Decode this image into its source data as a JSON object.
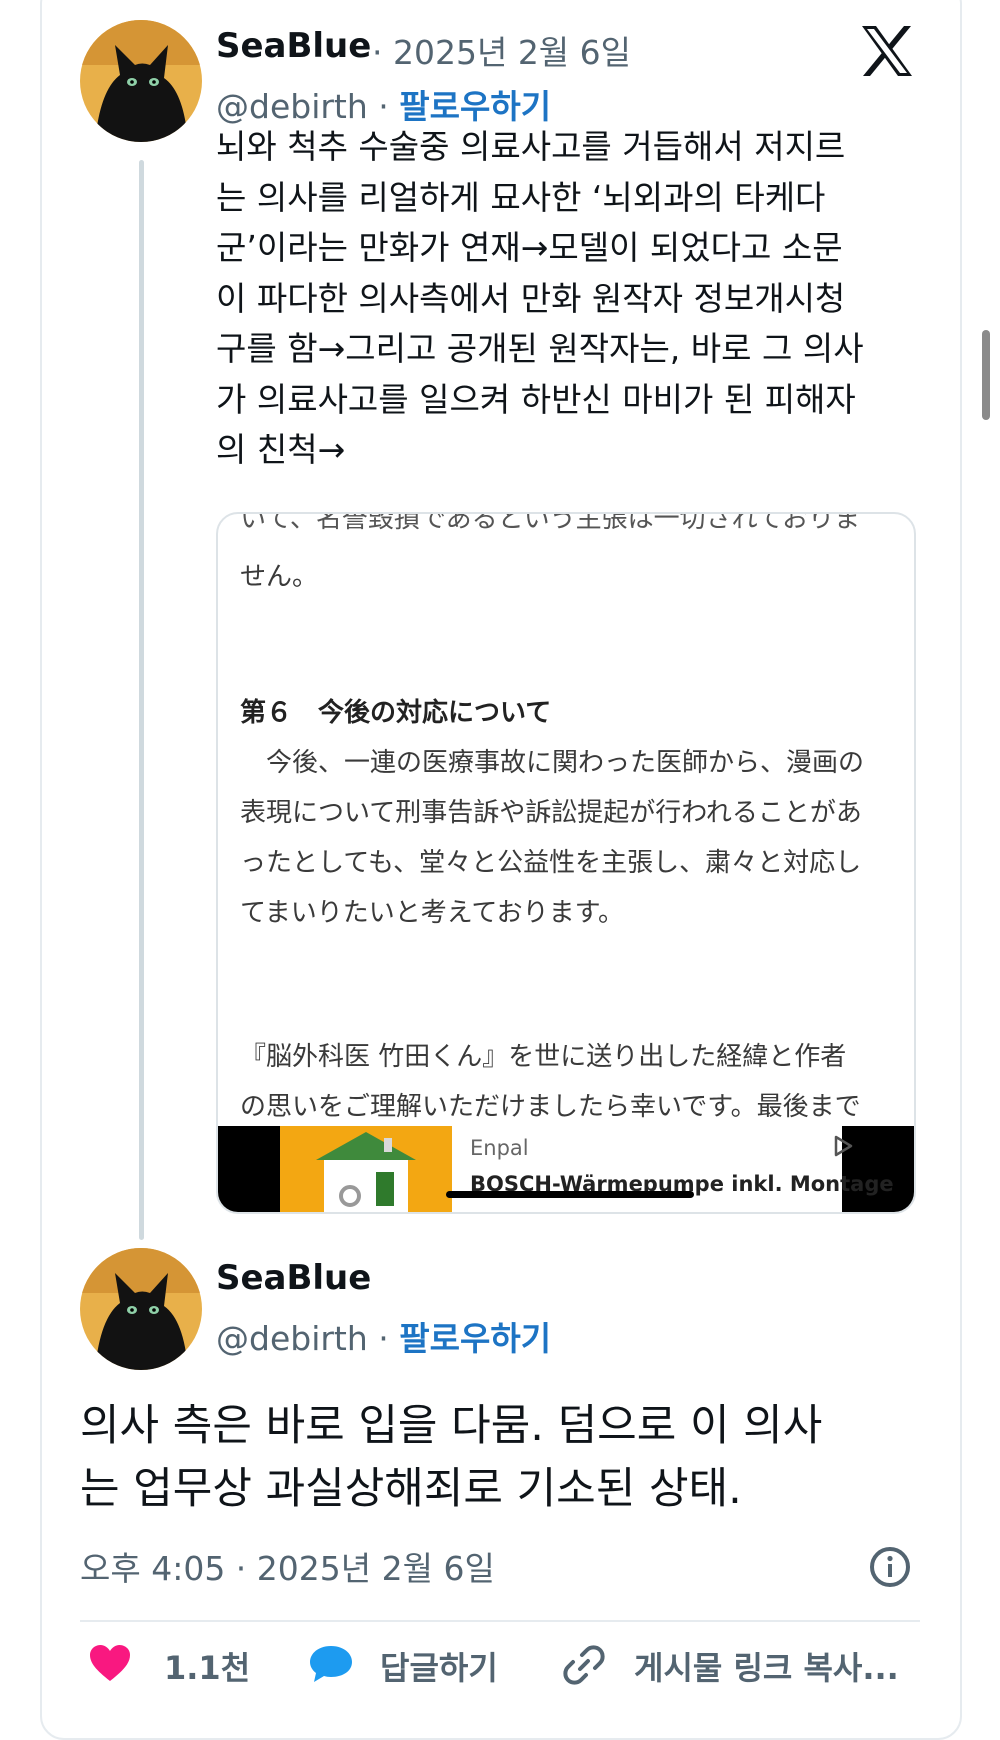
{
  "main_tweet": {
    "display_name": "SeaBlue",
    "handle": "@debirth",
    "date": "2025년 2월 6일",
    "follow_label": "팔로우하기",
    "text": "뇌와 척추 수술중 의료사고를 거듭해서 저지르\n는 의사를 리얼하게 묘사한 ‘뇌외과의 타케다\n군’이라는 만화가 연재→모델이 되었다고 소문\n이 파다한 의사측에서 만화 원작자 정보개시청\n구를 함→그리고 공개된 원작자는, 바로 그 의사\n가 의료사고를 일으켜 하반신 마비가 된 피해자\n의 친척→",
    "media": {
      "cut_line": "いて、名誉毀損であるという主張は一切されておりま",
      "line_after_cut": "せん。",
      "section_heading": "第６　今後の対応について",
      "paragraph": [
        "　今後、一連の医療事故に関わった医師から、漫画の",
        "表現について刑事告訴や訴訟提起が行われることがあ",
        "ったとしても、堂々と公益性を主張し、粛々と対応し",
        "てまいりたいと考えております。"
      ],
      "closing": [
        "『脳外科医 竹田くん』を世に送り出した経緯と作者",
        "の思いをご理解いただけましたら幸いです。最後まで"
      ],
      "ad": {
        "brand": "Enpal",
        "title": "BOSCH-Wärmepumpe inkl. Montage"
      }
    }
  },
  "reply_tweet": {
    "display_name": "SeaBlue",
    "handle": "@debirth",
    "follow_label": "팔로우하기",
    "text": "의사 측은 바로 입을 다뭄. 덤으로 이 의사\n는 업무상 과실상해죄로 기소된 상태.",
    "timestamp": "오후 4:05 · 2025년 2월 6일"
  },
  "actions": {
    "like_count": "1.1천",
    "reply_label": "답글하기",
    "copy_link_label": "게시물 링크 복사..."
  },
  "colors": {
    "follow_blue": "#1d74c4",
    "like_pink": "#f91880",
    "reply_blue": "#1d9bf0",
    "secondary_gray": "#536471"
  },
  "icons": [
    "x-logo-icon",
    "info-icon",
    "heart-icon",
    "reply-bubble-icon",
    "link-icon",
    "ad-choices-icon"
  ]
}
